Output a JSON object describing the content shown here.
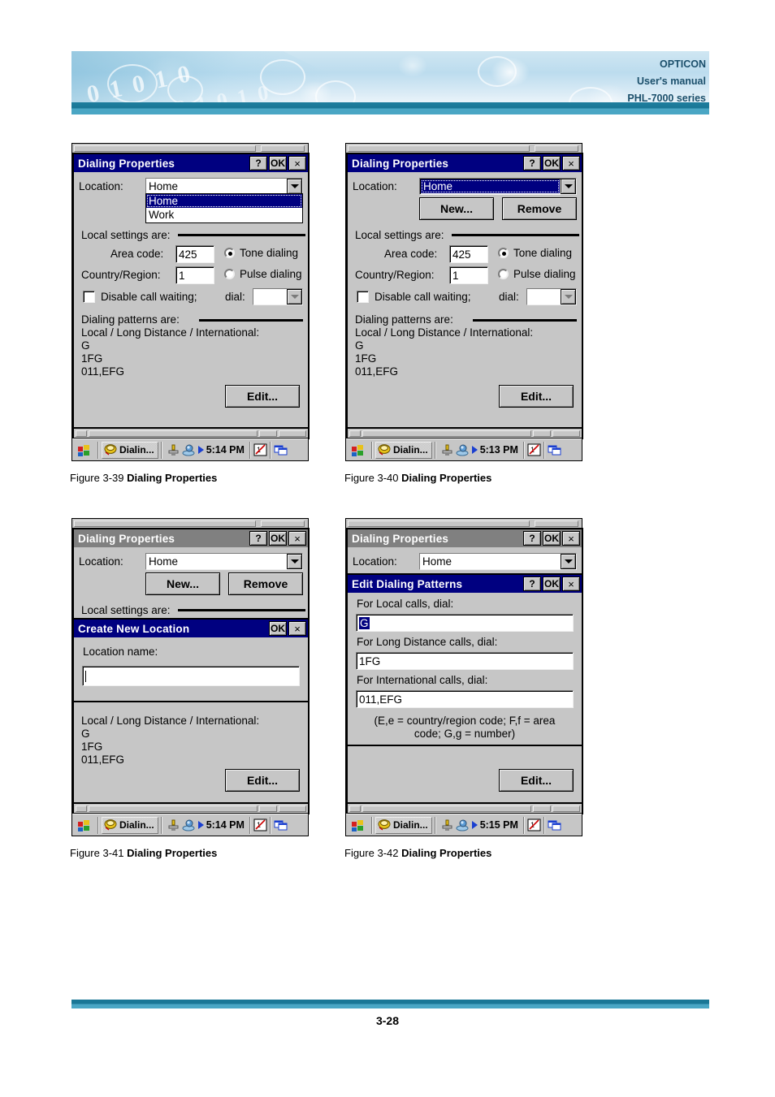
{
  "header": {
    "line1": "OPTICON",
    "line2": "User's manual",
    "line3": "PHL-7000 series",
    "watermark_digits": "0 1 0 1 0"
  },
  "common": {
    "dialing_properties_title": "Dialing Properties",
    "help_btn": "?",
    "ok_btn": "OK",
    "close_btn": "×",
    "location_label": "Location:",
    "location_value": "Home",
    "new_btn": "New...",
    "remove_btn": "Remove",
    "local_settings_label": "Local settings are:",
    "area_code_label": "Area code:",
    "area_code_value": "425",
    "country_label": "Country/Region:",
    "country_value": "1",
    "tone_dialing": "Tone dialing",
    "pulse_dialing": "Pulse dialing",
    "disable_call_waiting": "Disable call waiting;",
    "dial_label": "dial:",
    "dial_value": "",
    "dialing_patterns_label": "Dialing patterns are:",
    "patterns_caption": "Local / Long Distance / International:",
    "pattern_local": "G",
    "pattern_long": "1FG",
    "pattern_intl": "011,EFG",
    "edit_btn": "Edit...",
    "taskbar_task": "Dialin...",
    "accent_titlebar": "#000080",
    "accent_inactive_titlebar": "#808080",
    "face_color": "#c6c6c6"
  },
  "fig39": {
    "caption_prefix": "Figure 3-39 ",
    "caption_bold": "Dialing Properties",
    "dropdown_options": [
      "Home",
      "Work"
    ],
    "dropdown_selected": "Home",
    "time": "5:14 PM"
  },
  "fig40": {
    "caption_prefix": "Figure 3-40 ",
    "caption_bold": "Dialing Properties",
    "time": "5:13 PM"
  },
  "fig41": {
    "caption_prefix": "Figure 3-41 ",
    "caption_bold": "Dialing Properties",
    "modal_title": "Create New Location",
    "location_name_label": "Location name:",
    "location_name_value": "",
    "time": "5:14 PM"
  },
  "fig42": {
    "caption_prefix": "Figure 3-42 ",
    "caption_bold": "Dialing Properties",
    "modal_title": "Edit Dialing Patterns",
    "local_label": "For Local calls, dial:",
    "local_value": "G",
    "long_label": "For Long Distance calls, dial:",
    "long_value": "1FG",
    "intl_label": "For International calls, dial:",
    "intl_value": "011,EFG",
    "hint_line1": "(E,e = country/region code; F,f = area",
    "hint_line2": "code; G,g = number)",
    "time": "5:15 PM"
  },
  "footer": {
    "page_number": "3-28"
  }
}
